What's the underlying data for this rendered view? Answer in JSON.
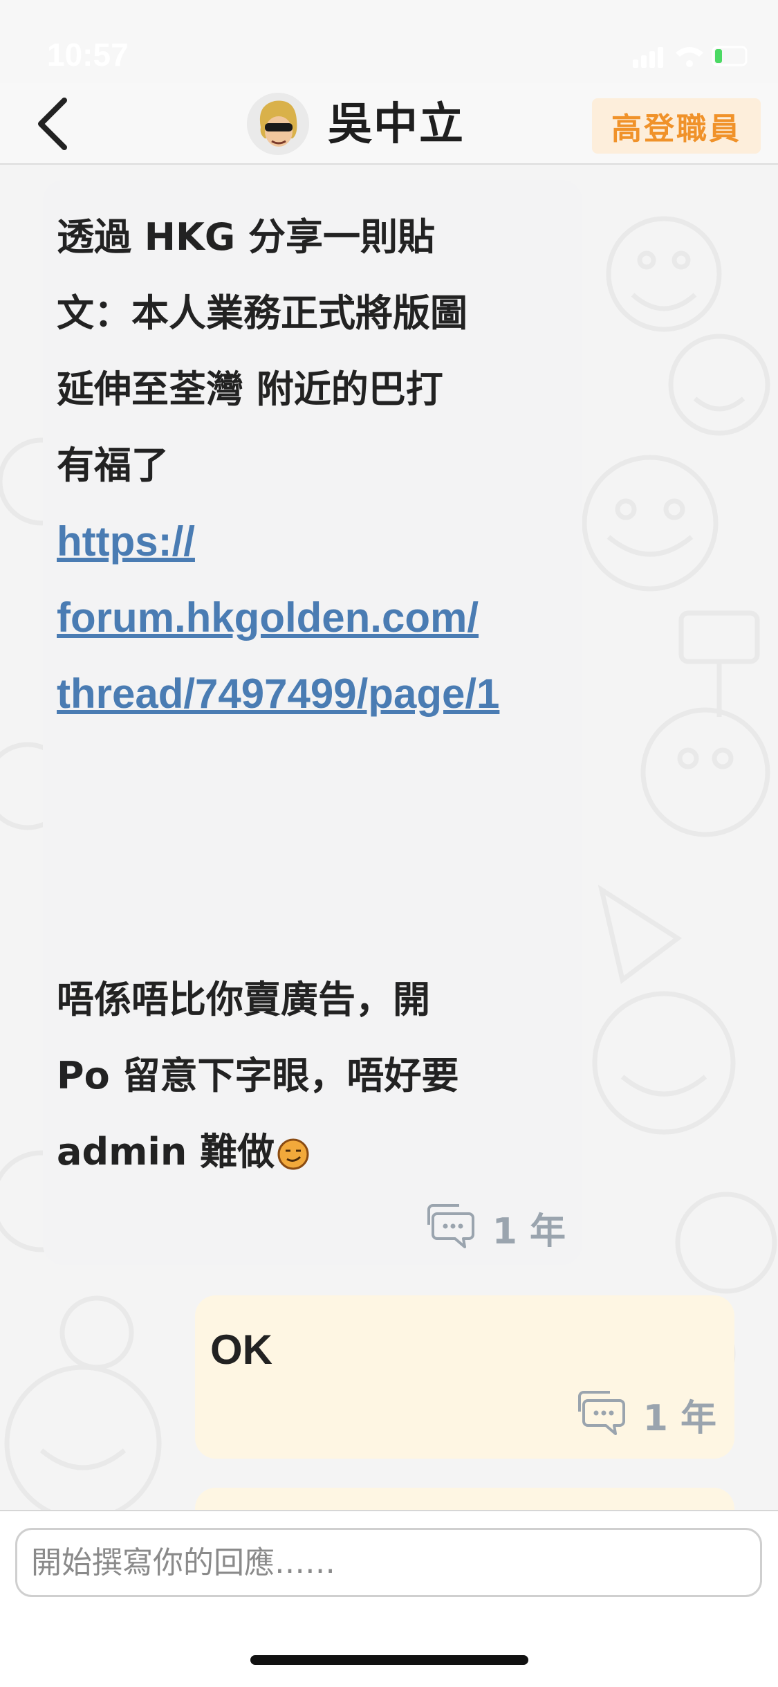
{
  "status_bar": {
    "time": "10:57"
  },
  "header": {
    "title": "吳中立",
    "badge": "高登職員"
  },
  "messages": [
    {
      "text": "透過 HKG 分享一則貼\n文：本人業務正式將版圖\n延伸至荃灣 附近的巴打\n有福了",
      "link": "https://\nforum.hkgolden.com/\nthread/7497499/page/1",
      "text2": "唔係唔比你賣廣告，開\nPo 留意下字眼，唔好要\nadmin 難做",
      "time": "1 年"
    },
    {
      "text": "OK",
      "time": "1 年"
    }
  ],
  "composer": {
    "placeholder": "開始撰寫你的回應……"
  },
  "colors": {
    "accent": "#f0922a",
    "link": "#4a7cb3",
    "outgoing_bubble": "#fef6e3"
  }
}
